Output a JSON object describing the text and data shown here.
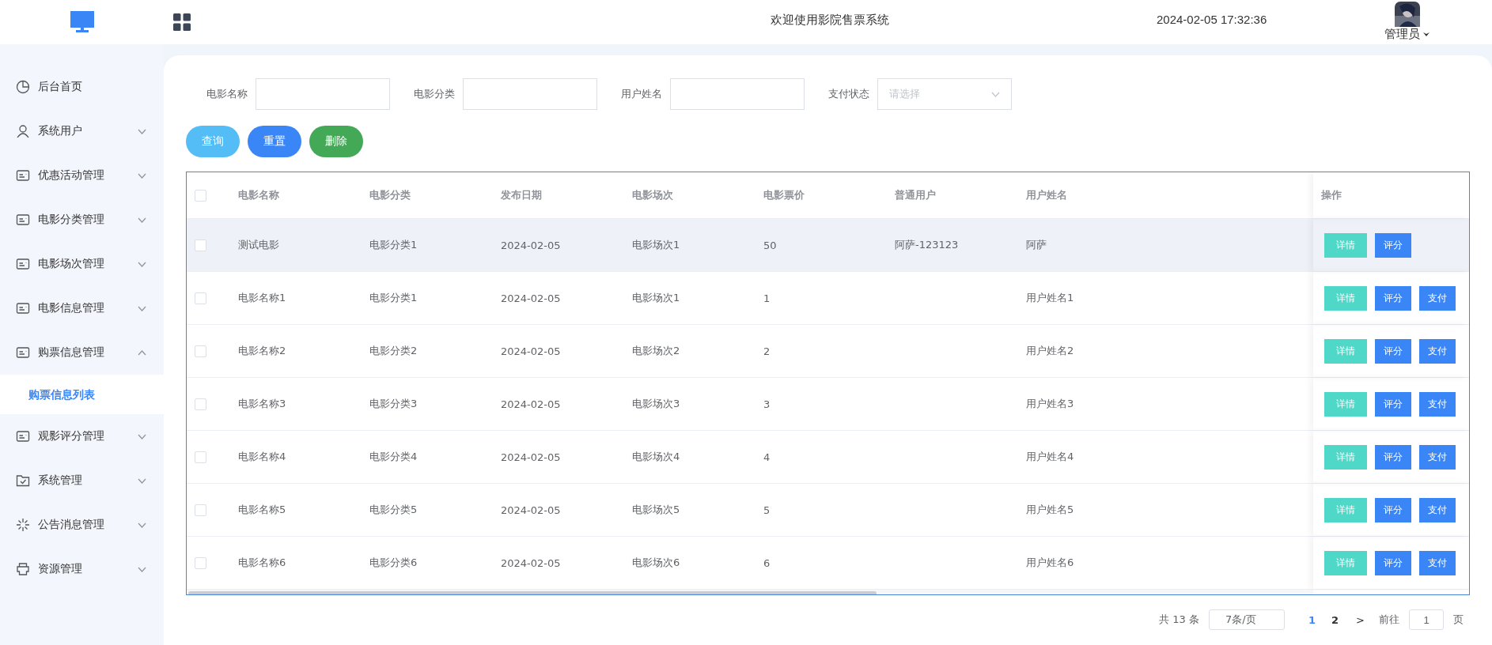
{
  "header": {
    "title": "欢迎使用影院售票系统",
    "datetime": "2024-02-05 17:32:36",
    "user": "管理员"
  },
  "sidebar": {
    "items": [
      {
        "label": "后台首页",
        "kind": "chart"
      },
      {
        "label": "系统用户",
        "kind": "user",
        "expanded": false
      },
      {
        "label": "优惠活动管理",
        "kind": "card",
        "expanded": false
      },
      {
        "label": "电影分类管理",
        "kind": "card",
        "expanded": false
      },
      {
        "label": "电影场次管理",
        "kind": "card",
        "expanded": false
      },
      {
        "label": "电影信息管理",
        "kind": "card",
        "expanded": false
      },
      {
        "label": "购票信息管理",
        "kind": "card",
        "expanded": true,
        "children": [
          {
            "label": "购票信息列表",
            "selected": true
          }
        ]
      },
      {
        "label": "观影评分管理",
        "kind": "card",
        "expanded": false
      },
      {
        "label": "系统管理",
        "kind": "folder",
        "expanded": false
      },
      {
        "label": "公告消息管理",
        "kind": "sparkle",
        "expanded": false
      },
      {
        "label": "资源管理",
        "kind": "printer",
        "expanded": false
      }
    ]
  },
  "filters": [
    {
      "label": "电影名称",
      "kind": "text"
    },
    {
      "label": "电影分类",
      "kind": "text"
    },
    {
      "label": "用户姓名",
      "kind": "text"
    },
    {
      "label": "支付状态",
      "kind": "select",
      "placeholder": "请选择"
    }
  ],
  "actions": [
    {
      "label": "查询",
      "kind": "search"
    },
    {
      "label": "重置",
      "kind": "reset"
    },
    {
      "label": "删除",
      "kind": "delete"
    }
  ],
  "table": {
    "columns": [
      "电影名称",
      "电影分类",
      "发布日期",
      "电影场次",
      "电影票价",
      "普通用户",
      "用户姓名",
      "操作"
    ],
    "header_checked": false,
    "rows": [
      {
        "checked": false,
        "hovered": true,
        "cells": [
          "测试电影",
          "电影分类1",
          "2024-02-05",
          "电影场次1",
          "50",
          "阿萨-123123",
          "阿萨"
        ],
        "buttons": [
          "详情",
          "评分"
        ]
      },
      {
        "checked": false,
        "hovered": false,
        "cells": [
          "电影名称1",
          "电影分类1",
          "2024-02-05",
          "电影场次1",
          "1",
          "",
          "用户姓名1"
        ],
        "buttons": [
          "详情",
          "评分",
          "支付"
        ]
      },
      {
        "checked": false,
        "hovered": false,
        "cells": [
          "电影名称2",
          "电影分类2",
          "2024-02-05",
          "电影场次2",
          "2",
          "",
          "用户姓名2"
        ],
        "buttons": [
          "详情",
          "评分",
          "支付"
        ]
      },
      {
        "checked": false,
        "hovered": false,
        "cells": [
          "电影名称3",
          "电影分类3",
          "2024-02-05",
          "电影场次3",
          "3",
          "",
          "用户姓名3"
        ],
        "buttons": [
          "详情",
          "评分",
          "支付"
        ]
      },
      {
        "checked": false,
        "hovered": false,
        "cells": [
          "电影名称4",
          "电影分类4",
          "2024-02-05",
          "电影场次4",
          "4",
          "",
          "用户姓名4"
        ],
        "buttons": [
          "详情",
          "评分",
          "支付"
        ]
      },
      {
        "checked": false,
        "hovered": false,
        "cells": [
          "电影名称5",
          "电影分类5",
          "2024-02-05",
          "电影场次5",
          "5",
          "",
          "用户姓名5"
        ],
        "buttons": [
          "详情",
          "评分",
          "支付"
        ]
      },
      {
        "checked": false,
        "hovered": false,
        "cells": [
          "电影名称6",
          "电影分类6",
          "2024-02-05",
          "电影场次6",
          "6",
          "",
          "用户姓名6"
        ],
        "buttons": [
          "详情",
          "评分",
          "支付"
        ]
      }
    ]
  },
  "pagination": {
    "total": "共 13 条",
    "page_size": "7条/页",
    "pages": [
      {
        "label": "1",
        "selected": true
      },
      {
        "label": "2",
        "selected": false
      }
    ],
    "next": ">",
    "goto_label": "前往",
    "goto_value": "1",
    "goto_suffix": "页"
  }
}
